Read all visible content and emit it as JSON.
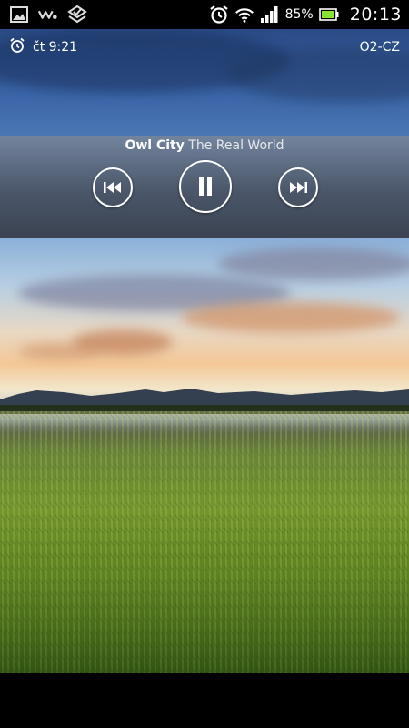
{
  "status_bar": {
    "battery_percent": "85%",
    "clock": "20:13",
    "icons": [
      "gallery-icon",
      "walkman-icon",
      "checklist-icon",
      "alarm-icon",
      "wifi-icon",
      "signal-icon",
      "battery-icon"
    ]
  },
  "lockscreen": {
    "alarm_text": "čt 9:21",
    "operator": "O2-CZ"
  },
  "music": {
    "artist": "Owl City",
    "title": "The Real World",
    "controls": [
      "previous",
      "pause",
      "next"
    ]
  },
  "colors": {
    "panel": "#4a5260",
    "accent": "#ffffff",
    "battery": "#8ae234"
  }
}
